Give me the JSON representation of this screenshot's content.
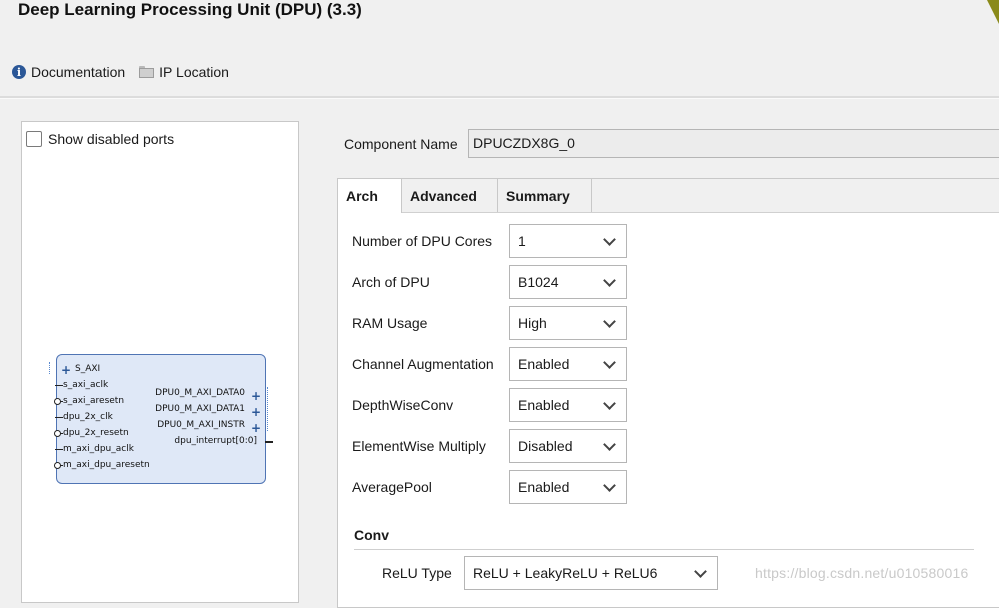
{
  "title": "Deep Learning Processing Unit (DPU) (3.3)",
  "toolbar": {
    "documentation": "Documentation",
    "ip_location": "IP Location",
    "documentation_icon": "info-icon",
    "ip_location_icon": "folder-icon"
  },
  "left_panel": {
    "show_disabled_ports": "Show disabled ports",
    "show_disabled_ports_checked": false,
    "block": {
      "left_ports": [
        "S_AXI",
        "s_axi_aclk",
        "s_axi_aresetn",
        "dpu_2x_clk",
        "dpu_2x_resetn",
        "m_axi_dpu_aclk",
        "m_axi_dpu_aresetn"
      ],
      "right_ports": [
        "DPU0_M_AXI_DATA0",
        "DPU0_M_AXI_DATA1",
        "DPU0_M_AXI_INSTR",
        "dpu_interrupt[0:0]"
      ]
    }
  },
  "component": {
    "label": "Component Name",
    "value": "DPUCZDX8G_0"
  },
  "tabs": [
    "Arch",
    "Advanced",
    "Summary"
  ],
  "arch": {
    "fields": [
      {
        "label": "Number of DPU Cores",
        "value": "1"
      },
      {
        "label": "Arch of DPU",
        "value": "B1024"
      },
      {
        "label": "RAM Usage",
        "value": "High"
      },
      {
        "label": "Channel Augmentation",
        "value": "Enabled"
      },
      {
        "label": "DepthWiseConv",
        "value": "Enabled"
      },
      {
        "label": "ElementWise Multiply",
        "value": "Disabled"
      },
      {
        "label": "AveragePool",
        "value": "Enabled"
      }
    ],
    "conv_section": "Conv",
    "relu_label": "ReLU Type",
    "relu_value": "ReLU + LeakyReLU + ReLU6"
  },
  "watermark": "https://blog.csdn.net/u010580016"
}
